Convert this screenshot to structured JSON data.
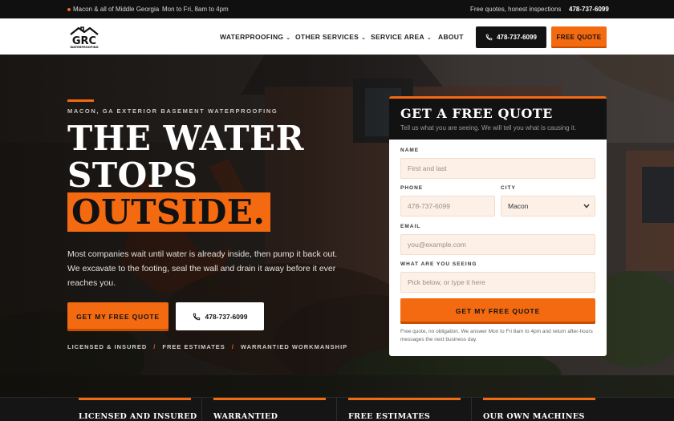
{
  "topbar": {
    "location": "Macon & all of Middle Georgia",
    "hours": "Mon to Fri, 8am to 4pm",
    "tagline": "Free quotes, honest inspections",
    "phone": "478-737-6099"
  },
  "brand": {
    "logo_text": "GRC",
    "logo_sub": "WATERPROOFING"
  },
  "nav": {
    "items": [
      {
        "label": "WATERPROOFING",
        "has_dropdown": true
      },
      {
        "label": "OTHER SERVICES",
        "has_dropdown": true
      },
      {
        "label": "SERVICE AREA",
        "has_dropdown": true
      },
      {
        "label": "ABOUT",
        "has_dropdown": false
      }
    ],
    "call_label": "478-737-6099",
    "quote_label": "FREE QUOTE"
  },
  "hero": {
    "eyebrow": "MACON, GA EXTERIOR BASEMENT WATERPROOFING",
    "headline_1": "THE WATER",
    "headline_2": "STOPS",
    "headline_3": "OUTSIDE.",
    "lead": "Most companies wait until water is already inside, then pump it back out. We excavate to the footing, seal the wall and drain it away before it ever reaches you.",
    "cta_quote": "GET MY FREE QUOTE",
    "cta_call": "478-737-6099",
    "badges": [
      "LICENSED & INSURED",
      "FREE ESTIMATES",
      "WARRANTIED WORKMANSHIP"
    ],
    "badge_sep": "/"
  },
  "form": {
    "title": "GET A FREE QUOTE",
    "subtitle": "Tell us what you are seeing. We will tell you what is causing it.",
    "name_label": "NAME",
    "name_placeholder": "First and last",
    "phone_label": "PHONE",
    "phone_placeholder": "478-737-6099",
    "city_label": "CITY",
    "city_value": "Macon",
    "email_label": "EMAIL",
    "email_placeholder": "you@example.com",
    "issue_label": "WHAT ARE YOU SEEING",
    "issue_placeholder": "Pick below, or type it here",
    "submit": "GET MY FREE QUOTE",
    "fine_print": "Free quote, no obligation. We answer Mon to Fri 8am to 4pm and return after-hours messages the next business day."
  },
  "features": [
    "LICENSED AND INSURED",
    "WARRANTIED",
    "FREE ESTIMATES",
    "OUR OWN MACHINES"
  ],
  "colors": {
    "accent": "#f36a10",
    "dark": "#121212",
    "field_bg": "#fdf0e6"
  },
  "icons": {
    "phone": "phone-icon",
    "chevron": "chevron-down-icon",
    "status": "status-dot-icon"
  }
}
